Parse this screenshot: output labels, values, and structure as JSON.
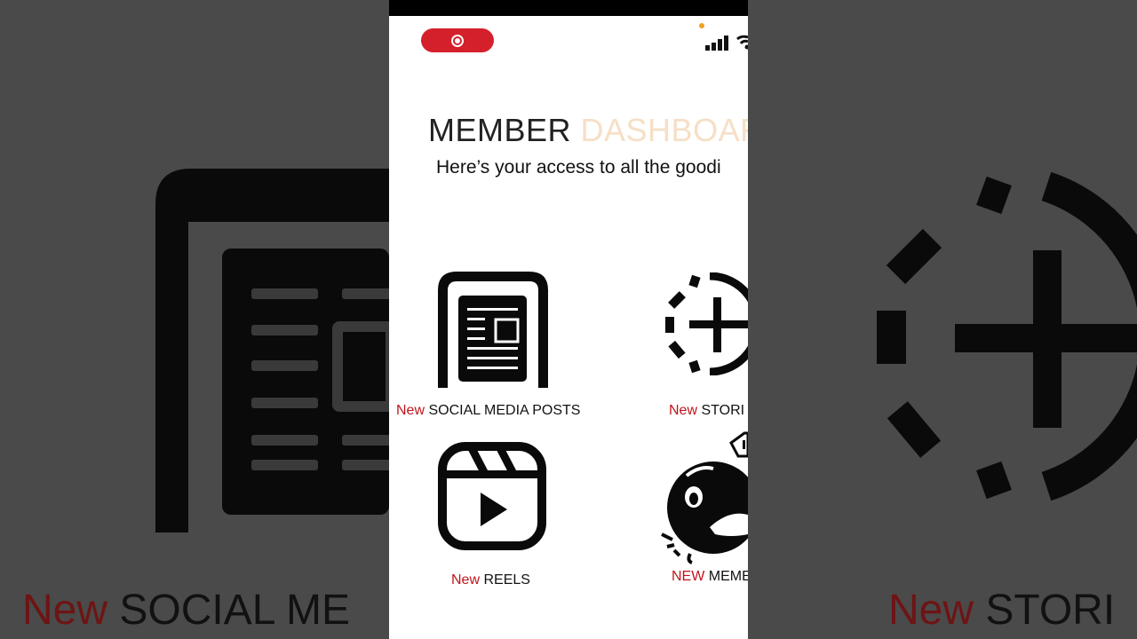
{
  "header": {
    "title_main": "MEMBER",
    "title_accent": "DASHBOAR",
    "subtitle": "Here’s your  access to all the goodi"
  },
  "tiles": [
    {
      "tag": "New",
      "label": "SOCIAL MEDIA POSTS",
      "icon": "news-post-icon"
    },
    {
      "tag": "New",
      "label": "STORI",
      "icon": "add-story-icon"
    },
    {
      "tag": "New",
      "label": "REELS",
      "icon": "reels-icon"
    },
    {
      "tag": "NEW",
      "label": "MEME",
      "icon": "meme-face-icon"
    }
  ],
  "background": {
    "left_tag": "New",
    "left_label": "SOCIAL ME",
    "right_tag": "New",
    "right_label": "STORI"
  },
  "colors": {
    "accent_red": "#c0141c",
    "record_pill": "#d4202a",
    "title_accent": "#f6dfc6"
  }
}
